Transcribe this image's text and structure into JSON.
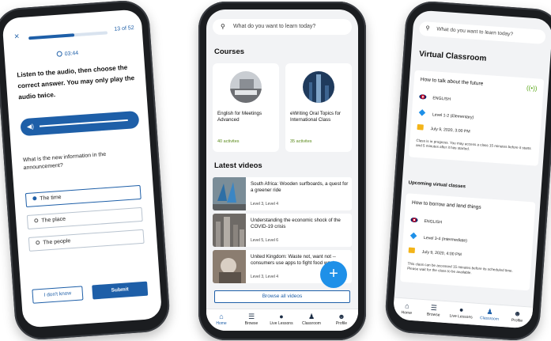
{
  "quiz": {
    "close_label": "×",
    "counter": "13 of 52",
    "progress_fraction": 0.58,
    "timer": "03:44",
    "instructions": "Listen to the audio, then choose the correct answer. You may only play the audio twice.",
    "question": "What is the new information in the announcement?",
    "options": [
      {
        "label": "The time",
        "selected": true
      },
      {
        "label": "The place",
        "selected": false
      },
      {
        "label": "The people",
        "selected": false
      }
    ],
    "dont_know_label": "I don't know",
    "submit_label": "Submit"
  },
  "browse": {
    "search_placeholder": "What do you want to learn today?",
    "courses_title": "Courses",
    "courses": [
      {
        "title": "English for Meetings Advanced",
        "count": "40 activites"
      },
      {
        "title": "eWriting Oral Topics for International Class",
        "count": "35 activites"
      }
    ],
    "videos_title": "Latest videos",
    "videos": [
      {
        "title": "South Africa: Wooden surfboards, a quest for a greener ride",
        "level": "Level 3, Level 4"
      },
      {
        "title": "Understanding the economic shock of the COVID-19 crisis",
        "level": "Level 5, Level 6"
      },
      {
        "title": "United Kingdom: Waste not, want not -- consumers use apps to fight food waste",
        "level": "Level 3, Level 4"
      }
    ],
    "browse_all_label": "Browse all videos",
    "fab_label": "+",
    "nav": [
      {
        "label": "Home",
        "icon": "home-icon",
        "active": true
      },
      {
        "label": "Browse",
        "icon": "list-icon",
        "active": false
      },
      {
        "label": "Live Lessons",
        "icon": "live-icon",
        "active": false
      },
      {
        "label": "Classroom",
        "icon": "group-icon",
        "active": false
      },
      {
        "label": "Profile",
        "icon": "user-icon",
        "active": false
      }
    ]
  },
  "classroom": {
    "search_placeholder": "What do you want to learn today?",
    "title": "Virtual Classroom",
    "current": {
      "title": "How to talk about the future",
      "language": "ENGLISH",
      "level": "Level 1-2 (Elementary)",
      "date": "July 9, 2020, 3:00 PM",
      "note": "Class is in progress. You may access a class 15 minutes before it starts and 5 minutes after it has started."
    },
    "upcoming_title": "Upcoming virtual classes",
    "upcoming": {
      "title": "How to borrow and lend things",
      "language": "ENGLISH",
      "level": "Level 3-4 (Intermediate)",
      "date": "July 9, 2020, 4:00 PM",
      "note": "This class can be accessed 15 minutes before its scheduled time. Please wait for the class to be available."
    },
    "nav": [
      {
        "label": "Home",
        "icon": "home-icon"
      },
      {
        "label": "Browse",
        "icon": "list-icon"
      },
      {
        "label": "Live Lessons",
        "icon": "live-icon"
      },
      {
        "label": "Classroom",
        "icon": "group-icon"
      },
      {
        "label": "Profile",
        "icon": "user-icon"
      }
    ]
  }
}
